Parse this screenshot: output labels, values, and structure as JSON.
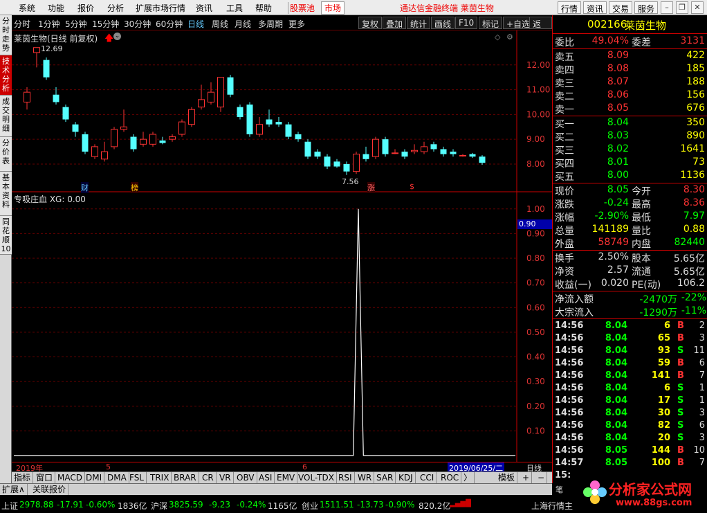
{
  "menu": {
    "items": [
      "系统",
      "功能",
      "报价",
      "分析",
      "扩展市场行情",
      "资讯",
      "工具",
      "帮助"
    ],
    "highlight": [
      "股票池",
      "市场"
    ],
    "title": "通达信金融终端  莱茵生物",
    "buttons": [
      "行情",
      "资讯",
      "交易",
      "服务"
    ]
  },
  "leftnav": [
    "分时走势",
    "技术分析",
    "成交明细",
    "分价表",
    "基本资料",
    "同花顺10"
  ],
  "period_bar": {
    "items": [
      "分时",
      "1分钟",
      "5分钟",
      "15分钟",
      "30分钟",
      "60分钟",
      "日线",
      "周线",
      "月线",
      "多周期",
      "更多"
    ],
    "selected": "日线",
    "buttons": [
      "复权",
      "叠加",
      "统计",
      "画线",
      "F10",
      "标记",
      "+自选",
      "返回"
    ]
  },
  "chart_header": {
    "title": "莱茵生物(日线 前复权)",
    "high_label": "12.69",
    "low_label": "7.56",
    "markers": [
      "财",
      "榜",
      "涨",
      "$"
    ]
  },
  "indicator_header": "专吸庄血 XG: 0.00",
  "indicator_value_tag": "0.90",
  "x_axis": {
    "labels": [
      "2019年",
      "5",
      "6"
    ],
    "cursor_date": "2019/06/25/二",
    "period": "日线"
  },
  "bottom_tabs": [
    "指标",
    "窗口",
    "MACD",
    "DMI",
    "DMA",
    "FSL",
    "TRIX",
    "BRAR",
    "CR",
    "VR",
    "OBV",
    "ASI",
    "EMV",
    "VOL-TDX",
    "RSI",
    "WR",
    "SAR",
    "KDJ",
    "CCI",
    "ROC"
  ],
  "bottom_right": {
    "template": "模板",
    "plus": "+",
    "minus": "−"
  },
  "expand_tabs": [
    "扩展∧",
    "关联报价"
  ],
  "chart_data": [
    {
      "type": "candlestick",
      "ylim": [
        7.3,
        13.0
      ],
      "yticks": [
        8.0,
        9.0,
        10.0,
        11.0,
        12.0
      ],
      "candles": [
        {
          "o": 10.5,
          "c": 10.9,
          "h": 11.1,
          "l": 10.2
        },
        {
          "o": 12.5,
          "c": 12.7,
          "h": 12.69,
          "l": 11.9
        },
        {
          "o": 12.2,
          "c": 11.5,
          "h": 12.3,
          "l": 11.4
        },
        {
          "o": 10.8,
          "c": 10.5,
          "h": 11.1,
          "l": 10.4
        },
        {
          "o": 10.3,
          "c": 9.8,
          "h": 10.4,
          "l": 9.7
        },
        {
          "o": 9.6,
          "c": 9.3,
          "h": 9.7,
          "l": 9.1
        },
        {
          "o": 9.2,
          "c": 8.5,
          "h": 9.3,
          "l": 8.4
        },
        {
          "o": 8.3,
          "c": 8.7,
          "h": 8.8,
          "l": 8.2
        },
        {
          "o": 8.2,
          "c": 8.5,
          "h": 8.9,
          "l": 8.1
        },
        {
          "o": 8.7,
          "c": 9.4,
          "h": 9.5,
          "l": 8.6
        },
        {
          "o": 9.4,
          "c": 9.5,
          "h": 10.2,
          "l": 9.3
        },
        {
          "o": 9.1,
          "c": 8.6,
          "h": 9.2,
          "l": 8.5
        },
        {
          "o": 8.8,
          "c": 9.0,
          "h": 9.3,
          "l": 8.7
        },
        {
          "o": 8.8,
          "c": 9.2,
          "h": 9.3,
          "l": 8.7
        },
        {
          "o": 8.95,
          "c": 8.85,
          "h": 9.1,
          "l": 8.8
        },
        {
          "o": 9.0,
          "c": 9.1,
          "h": 9.2,
          "l": 8.9
        },
        {
          "o": 9.2,
          "c": 9.7,
          "h": 9.8,
          "l": 9.1
        },
        {
          "o": 9.6,
          "c": 10.2,
          "h": 10.3,
          "l": 9.5
        },
        {
          "o": 10.3,
          "c": 10.6,
          "h": 11.2,
          "l": 10.2
        },
        {
          "o": 10.5,
          "c": 10.9,
          "h": 11.3,
          "l": 10.4
        },
        {
          "o": 10.3,
          "c": 11.5,
          "h": 11.5,
          "l": 10.1
        },
        {
          "o": 11.5,
          "c": 10.8,
          "h": 11.6,
          "l": 10.7
        },
        {
          "o": 10.3,
          "c": 9.9,
          "h": 10.4,
          "l": 9.8
        },
        {
          "o": 10.4,
          "c": 9.2,
          "h": 10.5,
          "l": 9.1
        },
        {
          "o": 9.2,
          "c": 9.6,
          "h": 9.9,
          "l": 9.1
        },
        {
          "o": 9.8,
          "c": 9.6,
          "h": 10.2,
          "l": 9.5
        },
        {
          "o": 9.7,
          "c": 9.6,
          "h": 9.9,
          "l": 9.5
        },
        {
          "o": 9.6,
          "c": 9.1,
          "h": 9.7,
          "l": 9.0
        },
        {
          "o": 9.2,
          "c": 9.0,
          "h": 9.3,
          "l": 8.9
        },
        {
          "o": 8.9,
          "c": 8.3,
          "h": 9.0,
          "l": 8.2
        },
        {
          "o": 8.5,
          "c": 8.3,
          "h": 8.6,
          "l": 8.2
        },
        {
          "o": 8.3,
          "c": 7.9,
          "h": 8.4,
          "l": 7.8
        },
        {
          "o": 8.1,
          "c": 7.9,
          "h": 8.2,
          "l": 7.85
        },
        {
          "o": 8.0,
          "c": 7.7,
          "h": 8.1,
          "l": 7.56
        },
        {
          "o": 7.7,
          "c": 8.4,
          "h": 8.5,
          "l": 7.6
        },
        {
          "o": 8.4,
          "c": 8.2,
          "h": 8.7,
          "l": 8.1
        },
        {
          "o": 8.3,
          "c": 9.0,
          "h": 9.1,
          "l": 8.2
        },
        {
          "o": 9.0,
          "c": 8.4,
          "h": 9.1,
          "l": 8.3
        },
        {
          "o": 8.45,
          "c": 8.45,
          "h": 8.6,
          "l": 8.4
        },
        {
          "o": 8.5,
          "c": 8.3,
          "h": 8.6,
          "l": 8.2
        },
        {
          "o": 8.5,
          "c": 8.55,
          "h": 8.8,
          "l": 8.4
        },
        {
          "o": 8.5,
          "c": 8.7,
          "h": 8.9,
          "l": 8.4
        },
        {
          "o": 8.8,
          "c": 8.6,
          "h": 8.9,
          "l": 8.5
        },
        {
          "o": 8.6,
          "c": 8.4,
          "h": 8.7,
          "l": 8.3
        },
        {
          "o": 8.5,
          "c": 8.4,
          "h": 8.6,
          "l": 8.3
        },
        {
          "o": 8.35,
          "c": 8.35,
          "h": 8.4,
          "l": 8.3
        },
        {
          "o": 8.4,
          "c": 8.3,
          "h": 8.45,
          "l": 8.25
        },
        {
          "o": 8.3,
          "c": 8.05,
          "h": 8.36,
          "l": 7.97
        }
      ]
    },
    {
      "type": "line",
      "title": "专吸庄血",
      "ylim": [
        0.0,
        1.05
      ],
      "yticks": [
        0.1,
        0.2,
        0.3,
        0.4,
        0.5,
        0.6,
        0.7,
        0.8,
        0.9,
        1.0
      ],
      "values": [
        0,
        0,
        0,
        0,
        0,
        0,
        0,
        0,
        0,
        0,
        0,
        0,
        0,
        0,
        0,
        0,
        0,
        0,
        0,
        0,
        0,
        0,
        0,
        0,
        0,
        0,
        0,
        0,
        0,
        0,
        0,
        0,
        0,
        0,
        0,
        0,
        0,
        0,
        0,
        0,
        0,
        0,
        0,
        0,
        0,
        0,
        0,
        0,
        0,
        0,
        0,
        0,
        0,
        0,
        0,
        0,
        0,
        0,
        0,
        0,
        0,
        0,
        0,
        0,
        0,
        0,
        0,
        0,
        1.0,
        0,
        0,
        0,
        0,
        0,
        0,
        0,
        0,
        0,
        0,
        0,
        0,
        0,
        0,
        0,
        0,
        0,
        0,
        0,
        0,
        0,
        0,
        0,
        0,
        0,
        0,
        0,
        0,
        0,
        0,
        0
      ]
    }
  ],
  "quote": {
    "code": "002166",
    "name": "莱茵生物",
    "weibi_label": "委比",
    "weibi": "49.04%",
    "weicha_label": "委差",
    "weicha": "3131",
    "asks": [
      {
        "label": "卖五",
        "price": "8.09",
        "vol": "422"
      },
      {
        "label": "卖四",
        "price": "8.08",
        "vol": "185"
      },
      {
        "label": "卖三",
        "price": "8.07",
        "vol": "188"
      },
      {
        "label": "卖二",
        "price": "8.06",
        "vol": "156"
      },
      {
        "label": "卖一",
        "price": "8.05",
        "vol": "676"
      }
    ],
    "bids": [
      {
        "label": "买一",
        "price": "8.04",
        "vol": "350"
      },
      {
        "label": "买二",
        "price": "8.03",
        "vol": "890"
      },
      {
        "label": "买三",
        "price": "8.02",
        "vol": "1641"
      },
      {
        "label": "买四",
        "price": "8.01",
        "vol": "73"
      },
      {
        "label": "买五",
        "price": "8.00",
        "vol": "1136"
      }
    ],
    "stats": [
      {
        "l1": "现价",
        "v1": "8.05",
        "c1": "green",
        "l2": "今开",
        "v2": "8.30",
        "c2": "red"
      },
      {
        "l1": "涨跌",
        "v1": "-0.24",
        "c1": "green",
        "l2": "最高",
        "v2": "8.36",
        "c2": "red"
      },
      {
        "l1": "涨幅",
        "v1": "-2.90%",
        "c1": "green",
        "l2": "最低",
        "v2": "7.97",
        "c2": "green"
      },
      {
        "l1": "总量",
        "v1": "141189",
        "c1": "yel",
        "l2": "量比",
        "v2": "0.88",
        "c2": "yel"
      },
      {
        "l1": "外盘",
        "v1": "58749",
        "c1": "red",
        "l2": "内盘",
        "v2": "82440",
        "c2": "green"
      }
    ],
    "fund": [
      {
        "l1": "换手",
        "v1": "2.50%",
        "l2": "股本",
        "v2": "5.65亿"
      },
      {
        "l1": "净资",
        "v1": "2.57",
        "l2": "流通",
        "v2": "5.65亿"
      },
      {
        "l1": "收益(一)",
        "v1": "0.020",
        "l2": "PE(动)",
        "v2": "106.2"
      }
    ],
    "flow": [
      {
        "label": "净流入额",
        "v": "-2470万",
        "p": "-22%"
      },
      {
        "label": "大宗流入",
        "v": "-1290万",
        "p": "-11%"
      }
    ],
    "ticks": [
      {
        "t": "14:56",
        "p": "8.04",
        "v": "6",
        "bs": "B",
        "n": "2"
      },
      {
        "t": "14:56",
        "p": "8.04",
        "v": "65",
        "bs": "B",
        "n": "3"
      },
      {
        "t": "14:56",
        "p": "8.04",
        "v": "93",
        "bs": "S",
        "n": "11"
      },
      {
        "t": "14:56",
        "p": "8.04",
        "v": "59",
        "bs": "B",
        "n": "6"
      },
      {
        "t": "14:56",
        "p": "8.04",
        "v": "141",
        "bs": "B",
        "n": "7"
      },
      {
        "t": "14:56",
        "p": "8.04",
        "v": "6",
        "bs": "S",
        "n": "1"
      },
      {
        "t": "14:56",
        "p": "8.04",
        "v": "17",
        "bs": "S",
        "n": "1"
      },
      {
        "t": "14:56",
        "p": "8.04",
        "v": "30",
        "bs": "S",
        "n": "3"
      },
      {
        "t": "14:56",
        "p": "8.04",
        "v": "82",
        "bs": "S",
        "n": "6"
      },
      {
        "t": "14:56",
        "p": "8.04",
        "v": "20",
        "bs": "S",
        "n": "3"
      },
      {
        "t": "14:56",
        "p": "8.05",
        "v": "144",
        "bs": "B",
        "n": "10"
      },
      {
        "t": "14:57",
        "p": "8.05",
        "v": "100",
        "bs": "B",
        "n": "7"
      },
      {
        "t": "15:",
        "p": "",
        "v": "",
        "bs": "",
        "n": ""
      }
    ],
    "bottom_tab": "笔"
  },
  "ticker": [
    {
      "name": "上证",
      "price": "2978.88",
      "chg": "-17.91",
      "pct": "-0.60%",
      "amt": "1836亿"
    },
    {
      "name": "沪深",
      "price": "3825.59",
      "chg": "-9.23",
      "pct": "-0.24%",
      "amt": "1165亿"
    },
    {
      "name": "创业",
      "price": "1511.51",
      "chg": "-13.73",
      "pct": "-0.90%",
      "amt": "820.2亿"
    }
  ],
  "ticker_right": "上海行情主",
  "watermark": {
    "text": "分析家公式网",
    "url": "www.88gs.com"
  }
}
